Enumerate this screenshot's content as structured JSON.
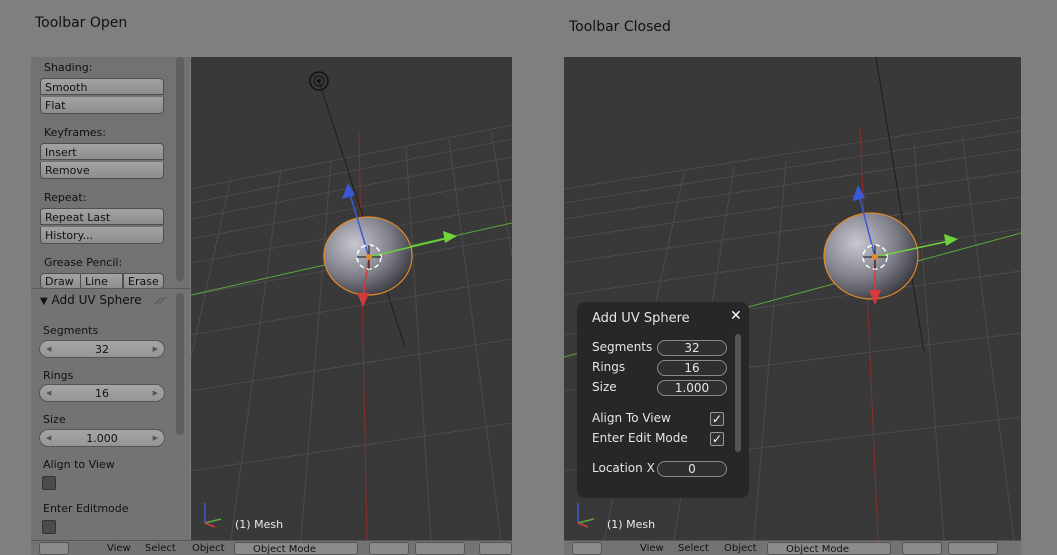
{
  "captions": {
    "left": "Toolbar Open",
    "right": "Toolbar Closed"
  },
  "toolbar": {
    "shading_label": "Shading:",
    "smooth": "Smooth",
    "flat": "Flat",
    "keyframes_label": "Keyframes:",
    "insert": "Insert",
    "remove": "Remove",
    "repeat_label": "Repeat:",
    "repeat_last": "Repeat Last",
    "history": "History...",
    "grease_label": "Grease Pencil:",
    "draw": "Draw",
    "line": "Line",
    "erase": "Erase"
  },
  "operator_left": {
    "title": "Add UV Sphere",
    "segments_label": "Segments",
    "segments": "32",
    "rings_label": "Rings",
    "rings": "16",
    "size_label": "Size",
    "size": "1.000",
    "align_label": "Align to View",
    "edit_label": "Enter Editmode"
  },
  "viewport": {
    "object_label": "(1) Mesh"
  },
  "header": {
    "view": "View",
    "select": "Select",
    "object": "Object",
    "mode": "Object Mode"
  },
  "redo_panel": {
    "title": "Add UV Sphere",
    "close": "✕",
    "segments_label": "Segments",
    "segments": "32",
    "rings_label": "Rings",
    "rings": "16",
    "size_label": "Size",
    "size": "1.000",
    "align_label": "Align To View",
    "edit_label": "Enter Edit Mode",
    "check": "✓",
    "location_label": "Location X",
    "location": "0"
  }
}
